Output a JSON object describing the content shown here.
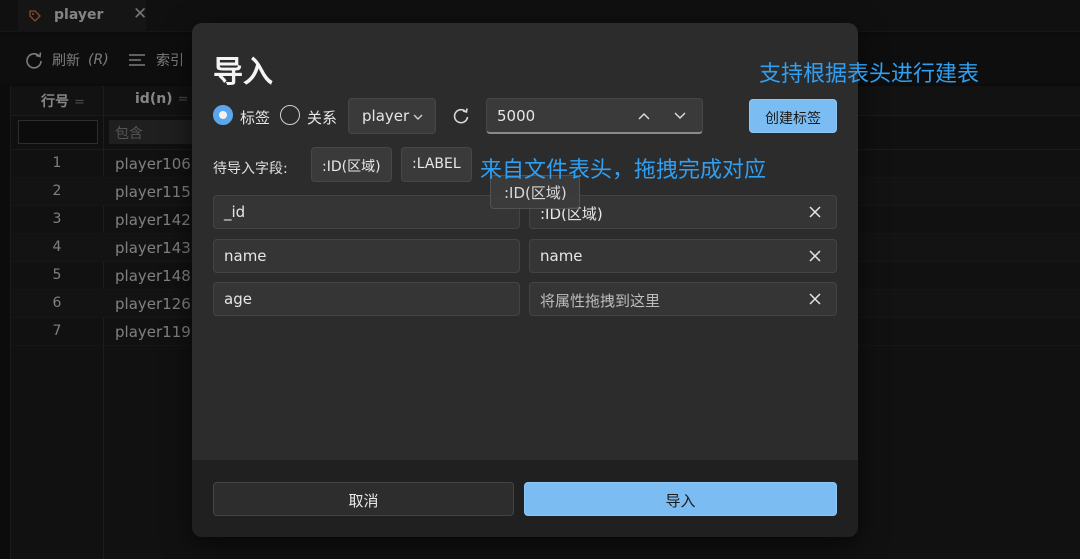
{
  "tab": {
    "title": "player",
    "close_glyph": "✕",
    "icon": "tag-icon"
  },
  "toolbar": {
    "refresh_label": "刷新",
    "refresh_shortcut": "(R)",
    "index_label": "索引"
  },
  "grid": {
    "columns": [
      {
        "label": "行号",
        "filter_glyph": "="
      },
      {
        "label": "id(n)",
        "filter_glyph": "="
      }
    ],
    "filter_placeholder": "包含",
    "rows": [
      {
        "num": "1",
        "id": "player106"
      },
      {
        "num": "2",
        "id": "player115"
      },
      {
        "num": "3",
        "id": "player142"
      },
      {
        "num": "4",
        "id": "player143"
      },
      {
        "num": "5",
        "id": "player148"
      },
      {
        "num": "6",
        "id": "player126"
      },
      {
        "num": "7",
        "id": "player119"
      }
    ]
  },
  "dialog": {
    "title": "导入",
    "radio_tag": "标签",
    "radio_relation": "关系",
    "selected_radio": "标签",
    "type_select_value": "player",
    "limit_value": "5000",
    "create_button": "创建标签",
    "pending_label": "待导入字段:",
    "pending_chips": [
      ":ID(区域)",
      ":LABEL"
    ],
    "drag_ghost": ":ID(区域)",
    "mappings": [
      {
        "source": "_id",
        "target": ":ID(区域)",
        "target_is_placeholder": false
      },
      {
        "source": "name",
        "target": "name",
        "target_is_placeholder": false
      },
      {
        "source": "age",
        "target": "将属性拖拽到这里",
        "target_is_placeholder": true
      }
    ],
    "cancel_button": "取消",
    "import_button": "导入"
  },
  "annotations": {
    "top": "支持根据表头进行建表",
    "middle": "来自文件表头，拖拽完成对应"
  },
  "colors": {
    "accent": "#7bbdf2",
    "annotation": "#2f9ff2",
    "dialog_bg": "#2c2c2c",
    "app_bg": "#141414"
  }
}
